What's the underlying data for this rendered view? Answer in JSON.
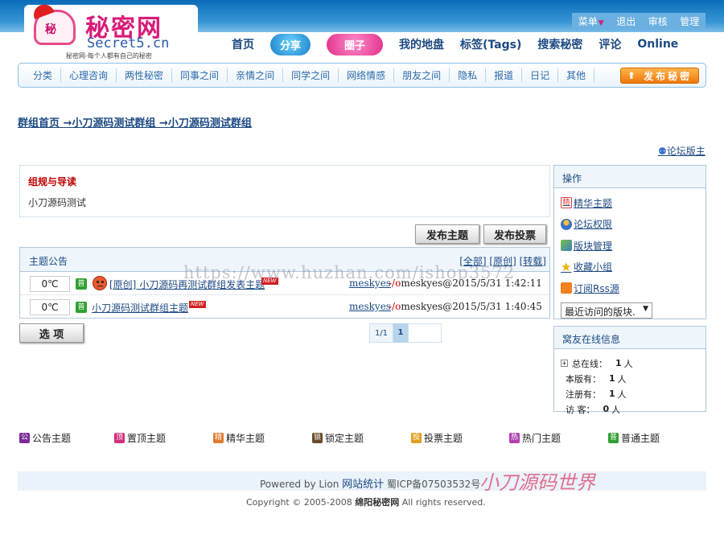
{
  "logo": {
    "mark": "秘",
    "title": "秘密网",
    "domain": "Secret5.cn",
    "slogan": "秘密网-每个人都有自己的秘密"
  },
  "top_links": [
    "菜单",
    "退出",
    "审核",
    "管理"
  ],
  "main_nav": [
    "首页",
    "分享",
    "圈子",
    "我的地盘",
    "标签(Tags)",
    "搜索秘密",
    "评论",
    "Online"
  ],
  "categories": [
    "分类",
    "心理咨询",
    "两性秘密",
    "同事之间",
    "亲情之间",
    "同学之间",
    "网络情感",
    "朋友之间",
    "隐私",
    "报道",
    "日记",
    "其他"
  ],
  "publish_secret": "发布秘密",
  "breadcrumb": "群组首页 →小刀源码测试群组 →小刀源码测试群组",
  "moderator_link": "论坛版主",
  "rules": {
    "title": "组规与导读",
    "text": "小刀源码测试"
  },
  "actions": {
    "post_topic": "发布主题",
    "post_poll": "发布投票",
    "options": "选 项"
  },
  "topics": {
    "header": "主题公告",
    "filters": [
      "[全部]",
      "[原创]",
      "[转载]"
    ],
    "rows": [
      {
        "temperature": "0℃",
        "tag": "普",
        "prefix": "[原创]",
        "title": "小刀源码再测试群组发表主题",
        "badge": "NEW",
        "author": "meskyes",
        "separator": "-/o",
        "last": "meskyes@2015/5/31 1:42:11"
      },
      {
        "temperature": "0℃",
        "tag": "普",
        "prefix": "",
        "title": "小刀源码测试群组主题",
        "badge": "NEW",
        "author": "meskyes",
        "separator": "-/o",
        "last": "meskyes@2015/5/31 1:40:45"
      }
    ]
  },
  "pager": {
    "count": "1/1",
    "current": "1"
  },
  "sidebar": {
    "ops_title": "操作",
    "ops": [
      {
        "icon": "jing-icon",
        "icon_text": "精",
        "label": "精华主题"
      },
      {
        "icon": "user-icon",
        "label": "论坛权限"
      },
      {
        "icon": "board-icon",
        "label": "版块管理"
      },
      {
        "icon": "star-icon",
        "icon_text": "★",
        "label": "收藏小组"
      },
      {
        "icon": "rss-icon",
        "label": "订阅Rss源"
      }
    ],
    "recent_select": "最近访问的版块.",
    "online_title": "窝友在线信息",
    "online": [
      {
        "label": "总在线：",
        "count": "1",
        "unit": "人"
      },
      {
        "label": "本版有：",
        "count": "1",
        "unit": "人"
      },
      {
        "label": "注册有：",
        "count": "1",
        "unit": "人"
      },
      {
        "label": "访 客：",
        "count": "0",
        "unit": "人"
      }
    ]
  },
  "legend": [
    {
      "icon": "公",
      "label": "公告主题",
      "color": "#7a2a9a"
    },
    {
      "icon": "顶",
      "label": "置顶主题",
      "color": "#d0307a"
    },
    {
      "icon": "精",
      "label": "精华主题",
      "color": "#e07a30"
    },
    {
      "icon": "锁",
      "label": "锁定主题",
      "color": "#6a4a2a"
    },
    {
      "icon": "投",
      "label": "投票主题",
      "color": "#e0a020"
    },
    {
      "icon": "热",
      "label": "热门主题",
      "color": "#b040b0"
    },
    {
      "icon": "普",
      "label": "普通主题",
      "color": "#30a030"
    }
  ],
  "footer": {
    "powered": "Powered by Lion",
    "stats": "网站统计",
    "icp": "蜀ICP备07503532号",
    "copyright": "Copyright © 2005-2008",
    "site": "绵阳秘密网",
    "rights": "All rights reserved."
  },
  "watermarks": {
    "url": "https://www.huzhan.com/ishop3572",
    "brand": "小刀源码世界"
  }
}
